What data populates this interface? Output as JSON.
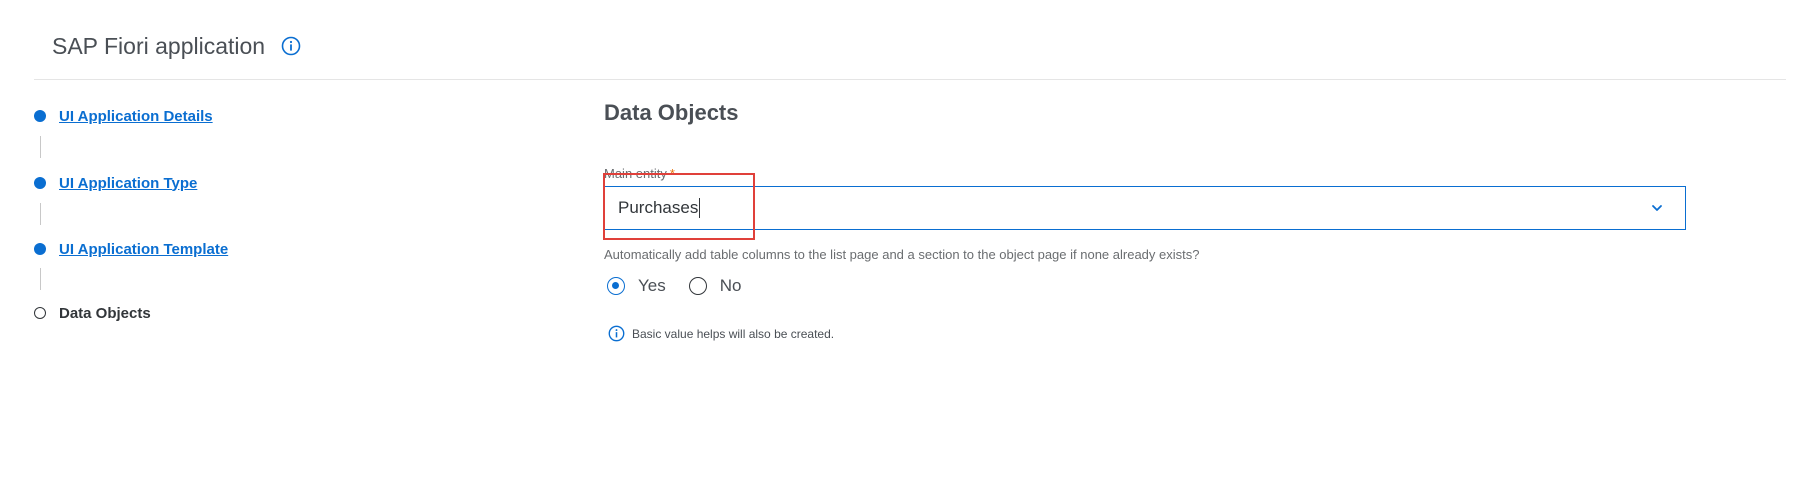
{
  "header": {
    "title": "SAP Fiori application",
    "info_icon": "info-icon"
  },
  "steps": [
    {
      "label": "UI Application Details",
      "state": "completed"
    },
    {
      "label": "UI Application Type",
      "state": "completed"
    },
    {
      "label": "UI Application Template",
      "state": "completed"
    },
    {
      "label": "Data Objects",
      "state": "current"
    }
  ],
  "main": {
    "section_title": "Data Objects",
    "main_entity": {
      "label": "Main entity",
      "required_marker": "*",
      "value": "Purchases",
      "dropdown_icon": "chevron-down-icon"
    },
    "auto_add_question": "Automatically add table columns to the list page and a section to the object page if none already exists?",
    "radio_options": [
      {
        "label": "Yes",
        "selected": true
      },
      {
        "label": "No",
        "selected": false
      }
    ],
    "info_note": "Basic value helps will also be created."
  },
  "colors": {
    "accent": "#0a6ed1",
    "highlight": "#e0403a",
    "required": "#e9730c"
  }
}
